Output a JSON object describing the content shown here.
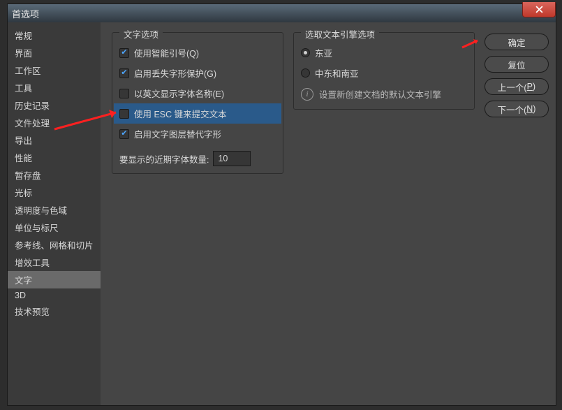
{
  "window": {
    "title": "首选项"
  },
  "sidebar": {
    "items": [
      "常规",
      "界面",
      "工作区",
      "工具",
      "历史记录",
      "文件处理",
      "导出",
      "性能",
      "暂存盘",
      "光标",
      "透明度与色域",
      "单位与标尺",
      "参考线、网格和切片",
      "增效工具",
      "文字",
      "3D",
      "技术预览"
    ],
    "selected_index": 14
  },
  "text_options": {
    "group_title": "文字选项",
    "smart_quotes": {
      "label": "使用智能引号(Q)",
      "checked": true
    },
    "glyph_protection": {
      "label": "启用丢失字形保护(G)",
      "checked": true
    },
    "english_font_names": {
      "label": "以英文显示字体名称(E)",
      "checked": false
    },
    "esc_commit": {
      "label": "使用 ESC 键来提交文本",
      "checked": false
    },
    "glyph_alternates": {
      "label": "启用文字图层替代字形",
      "checked": true
    },
    "recent_fonts": {
      "label": "要显示的近期字体数量:",
      "value": "10"
    }
  },
  "engine": {
    "group_title": "选取文本引擎选项",
    "east_asia": {
      "label": "东亚",
      "selected": true
    },
    "middle_east": {
      "label": "中东和南亚",
      "selected": false
    },
    "info_text": "设置新创建文档的默认文本引擎"
  },
  "buttons": {
    "ok": "确定",
    "reset": "复位",
    "prev": "上一个(",
    "prev_key": "P",
    "prev_tail": ")",
    "next": "下一个(",
    "next_key": "N",
    "next_tail": ")"
  }
}
